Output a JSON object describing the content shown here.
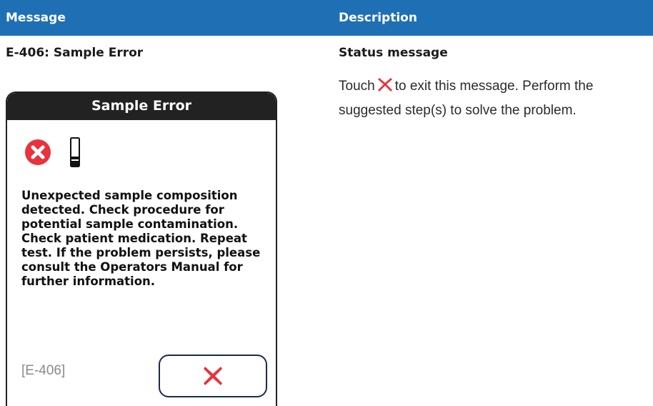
{
  "header": {
    "message_col": "Message",
    "description_col": "Description"
  },
  "row": {
    "message_code": "E-406: Sample Error",
    "status_title": "Status message",
    "description": {
      "before": "Touch",
      "after": "to exit this message. Perform the suggested step(s) to solve the problem."
    }
  },
  "dialog": {
    "title": "Sample Error",
    "body": "Unexpected sample composition detected. Check procedure for potential sample contamination. Check patient medication. Repeat test. If the problem persists, please consult the Operators Manual for further information.",
    "error_code": "[E-406]",
    "close_icon": "close-x-icon"
  },
  "colors": {
    "header_bg": "#1f6fb4",
    "dialog_title_bg": "#222222",
    "error_red": "#e8323c",
    "button_border": "#1a2a4f"
  }
}
